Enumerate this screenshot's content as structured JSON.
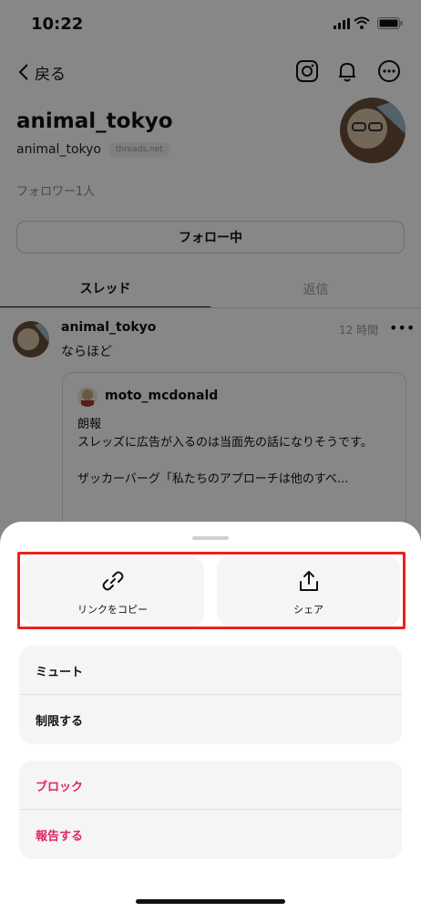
{
  "status_bar": {
    "time": "10:22"
  },
  "header": {
    "back_label": "戻る"
  },
  "profile": {
    "username": "animal_tokyo",
    "handle": "animal_tokyo",
    "domain_badge": "threads.net",
    "followers": "フォロワー1人",
    "follow_button": "フォロー中"
  },
  "tabs": [
    {
      "label": "スレッド"
    },
    {
      "label": "返信"
    }
  ],
  "post": {
    "user": "animal_tokyo",
    "time": "12 時間",
    "text": "ならほど",
    "quote": {
      "user": "moto_mcdonald",
      "lines": [
        "朗報",
        "スレッズに広告が入るのは当面先の話になりそうです。",
        "",
        "ザッカーバーグ「私たちのアプローチは他のすべ..."
      ]
    }
  },
  "sheet": {
    "copy_link_label": "リンクをコピー",
    "share_label": "シェア",
    "mute_label": "ミュート",
    "restrict_label": "制限する",
    "block_label": "ブロック",
    "report_label": "報告する",
    "highlight_color": "#e8231b",
    "danger_color": "#e0245e"
  }
}
